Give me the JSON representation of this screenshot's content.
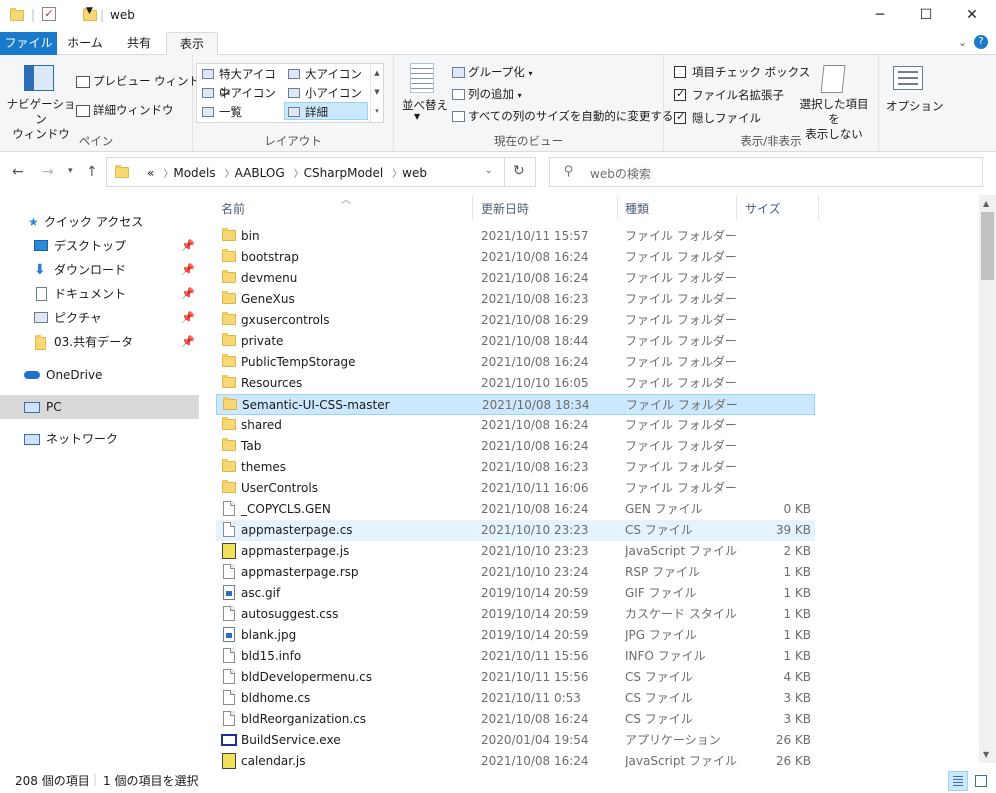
{
  "window": {
    "title": "web",
    "minimize": "─",
    "maximize": "☐",
    "close": "✕"
  },
  "tabs": [
    "ファイル",
    "ホーム",
    "共有",
    "表示"
  ],
  "ribbon": {
    "panes": {
      "nav_pane": "ナビゲーション\nウィンドウ",
      "preview": "プレビュー ウィンドウ",
      "details": "詳細ウィンドウ",
      "label": "ペイン"
    },
    "layout": {
      "items": [
        "特大アイコン",
        "大アイコン",
        "中アイコン",
        "小アイコン",
        "一覧",
        "詳細"
      ],
      "selected": "詳細",
      "label": "レイアウト"
    },
    "current_view": {
      "sort": "並べ替え",
      "group": "グループ化",
      "add_columns": "列の追加",
      "autosize": "すべての列のサイズを自動的に変更する",
      "label": "現在のビュー"
    },
    "show_hide": {
      "item_checkboxes": "項目チェック ボックス",
      "extensions": "ファイル名拡張子",
      "hidden_items": "隠しファイル",
      "hide_selected": "選択した項目を\n表示しない",
      "label": "表示/非表示",
      "states": [
        false,
        true,
        true
      ]
    },
    "options": "オプション"
  },
  "address": {
    "prefix": "«",
    "crumbs": [
      "Models",
      "AABLOG",
      "CSharpModel",
      "web"
    ],
    "search_placeholder": "webの検索"
  },
  "nav": [
    {
      "label": "クイック アクセス",
      "icon": "star-icon",
      "pinned": false
    },
    {
      "label": "デスクトップ",
      "icon": "desktop-icon",
      "pinned": true
    },
    {
      "label": "ダウンロード",
      "icon": "download-icon",
      "pinned": true
    },
    {
      "label": "ドキュメント",
      "icon": "documents-icon",
      "pinned": true
    },
    {
      "label": "ピクチャ",
      "icon": "pictures-icon",
      "pinned": true
    },
    {
      "label": "03.共有データ",
      "icon": "folder-icon",
      "pinned": true
    },
    {
      "label": "OneDrive",
      "icon": "cloud-icon",
      "pinned": false
    },
    {
      "label": "PC",
      "icon": "pc-icon",
      "pinned": false
    },
    {
      "label": "ネットワーク",
      "icon": "network-icon",
      "pinned": false
    }
  ],
  "columns": {
    "name": "名前",
    "date": "更新日時",
    "type": "種類",
    "size": "サイズ"
  },
  "files": [
    {
      "name": "bin",
      "date": "2021/10/11 15:57",
      "type": "ファイル フォルダー",
      "size": "",
      "kind": "folder"
    },
    {
      "name": "bootstrap",
      "date": "2021/10/08 16:24",
      "type": "ファイル フォルダー",
      "size": "",
      "kind": "folder"
    },
    {
      "name": "devmenu",
      "date": "2021/10/08 16:24",
      "type": "ファイル フォルダー",
      "size": "",
      "kind": "folder"
    },
    {
      "name": "GeneXus",
      "date": "2021/10/08 16:23",
      "type": "ファイル フォルダー",
      "size": "",
      "kind": "folder"
    },
    {
      "name": "gxusercontrols",
      "date": "2021/10/08 16:29",
      "type": "ファイル フォルダー",
      "size": "",
      "kind": "folder"
    },
    {
      "name": "private",
      "date": "2021/10/08 18:44",
      "type": "ファイル フォルダー",
      "size": "",
      "kind": "folder"
    },
    {
      "name": "PublicTempStorage",
      "date": "2021/10/08 16:24",
      "type": "ファイル フォルダー",
      "size": "",
      "kind": "folder"
    },
    {
      "name": "Resources",
      "date": "2021/10/10 16:05",
      "type": "ファイル フォルダー",
      "size": "",
      "kind": "folder"
    },
    {
      "name": "Semantic-UI-CSS-master",
      "date": "2021/10/08 18:34",
      "type": "ファイル フォルダー",
      "size": "",
      "kind": "folder"
    },
    {
      "name": "shared",
      "date": "2021/10/08 16:24",
      "type": "ファイル フォルダー",
      "size": "",
      "kind": "folder"
    },
    {
      "name": "Tab",
      "date": "2021/10/08 16:24",
      "type": "ファイル フォルダー",
      "size": "",
      "kind": "folder"
    },
    {
      "name": "themes",
      "date": "2021/10/08 16:23",
      "type": "ファイル フォルダー",
      "size": "",
      "kind": "folder"
    },
    {
      "name": "UserControls",
      "date": "2021/10/11 16:06",
      "type": "ファイル フォルダー",
      "size": "",
      "kind": "folder"
    },
    {
      "name": "_COPYCLS.GEN",
      "date": "2021/10/08 16:24",
      "type": "GEN ファイル",
      "size": "0 KB",
      "kind": "doc"
    },
    {
      "name": "appmasterpage.cs",
      "date": "2021/10/10 23:23",
      "type": "CS ファイル",
      "size": "39 KB",
      "kind": "doc"
    },
    {
      "name": "appmasterpage.js",
      "date": "2021/10/10 23:23",
      "type": "JavaScript ファイル",
      "size": "2 KB",
      "kind": "js"
    },
    {
      "name": "appmasterpage.rsp",
      "date": "2021/10/10 23:24",
      "type": "RSP ファイル",
      "size": "1 KB",
      "kind": "doc"
    },
    {
      "name": "asc.gif",
      "date": "2019/10/14 20:59",
      "type": "GIF ファイル",
      "size": "1 KB",
      "kind": "img"
    },
    {
      "name": "autosuggest.css",
      "date": "2019/10/14 20:59",
      "type": "カスケード スタイル シ...",
      "size": "1 KB",
      "kind": "doc"
    },
    {
      "name": "blank.jpg",
      "date": "2019/10/14 20:59",
      "type": "JPG ファイル",
      "size": "1 KB",
      "kind": "img"
    },
    {
      "name": "bld15.info",
      "date": "2021/10/11 15:56",
      "type": "INFO ファイル",
      "size": "1 KB",
      "kind": "doc"
    },
    {
      "name": "bldDevelopermenu.cs",
      "date": "2021/10/11 15:56",
      "type": "CS ファイル",
      "size": "4 KB",
      "kind": "doc"
    },
    {
      "name": "bldhome.cs",
      "date": "2021/10/11 0:53",
      "type": "CS ファイル",
      "size": "3 KB",
      "kind": "doc"
    },
    {
      "name": "bldReorganization.cs",
      "date": "2021/10/08 16:24",
      "type": "CS ファイル",
      "size": "3 KB",
      "kind": "doc"
    },
    {
      "name": "BuildService.exe",
      "date": "2020/01/04 19:54",
      "type": "アプリケーション",
      "size": "26 KB",
      "kind": "exe"
    },
    {
      "name": "calendar.js",
      "date": "2021/10/08 16:24",
      "type": "JavaScript ファイル",
      "size": "26 KB",
      "kind": "js"
    }
  ],
  "selected_index": 8,
  "hover_index": 14,
  "status": {
    "count": "208 個の項目",
    "selected": "1 個の項目を選択"
  },
  "colors": {
    "accent": "#1979ca",
    "selection": "#cce8ff",
    "selection_border": "#99d1ff"
  }
}
